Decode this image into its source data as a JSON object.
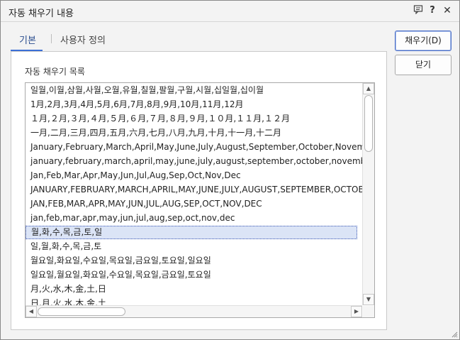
{
  "window": {
    "title": "자동 채우기 내용",
    "help_label": "?",
    "close_label": "✕",
    "resize_icon": "resize-grip-icon"
  },
  "tabs": [
    {
      "label": "기본",
      "active": true
    },
    {
      "label": "사용자 정의",
      "active": false
    }
  ],
  "panel": {
    "group_label": "자동 채우기 목록",
    "selected_index": 10,
    "items": [
      "일월,이월,삼월,사월,오월,유월,칠월,팔월,구월,시월,십일월,십이월",
      "1月,2月,3月,4月,5月,6月,7月,8月,9月,10月,11月,12月",
      "１月,２月,３月,４月,５月,６月,７月,８月,９月,１０月,１１月,１２月",
      "一月,二月,三月,四月,五月,六月,七月,八月,九月,十月,十一月,十二月",
      "January,February,March,April,May,June,July,August,September,October,November,December",
      "january,february,march,april,may,june,july,august,september,october,november,december",
      "Jan,Feb,Mar,Apr,May,Jun,Jul,Aug,Sep,Oct,Nov,Dec",
      "JANUARY,FEBRUARY,MARCH,APRIL,MAY,JUNE,JULY,AUGUST,SEPTEMBER,OCTOBER,NOVEMBER,DECEMBER",
      "JAN,FEB,MAR,APR,MAY,JUN,JUL,AUG,SEP,OCT,NOV,DEC",
      "jan,feb,mar,apr,may,jun,jul,aug,sep,oct,nov,dec",
      "월,화,수,목,금,토,일",
      "일,월,화,수,목,금,토",
      "월요일,화요일,수요일,목요일,금요일,토요일,일요일",
      "일요일,월요일,화요일,수요일,목요일,금요일,토요일",
      "月,火,水,木,金,土,日",
      "日,月,火,水,木,金,土"
    ]
  },
  "buttons": {
    "fill_label": "채우기(D)",
    "close_label": "닫기"
  },
  "scrollbar": {
    "up_arrow": "▲",
    "down_arrow": "▼",
    "left_arrow": "◀",
    "right_arrow": "▶"
  }
}
